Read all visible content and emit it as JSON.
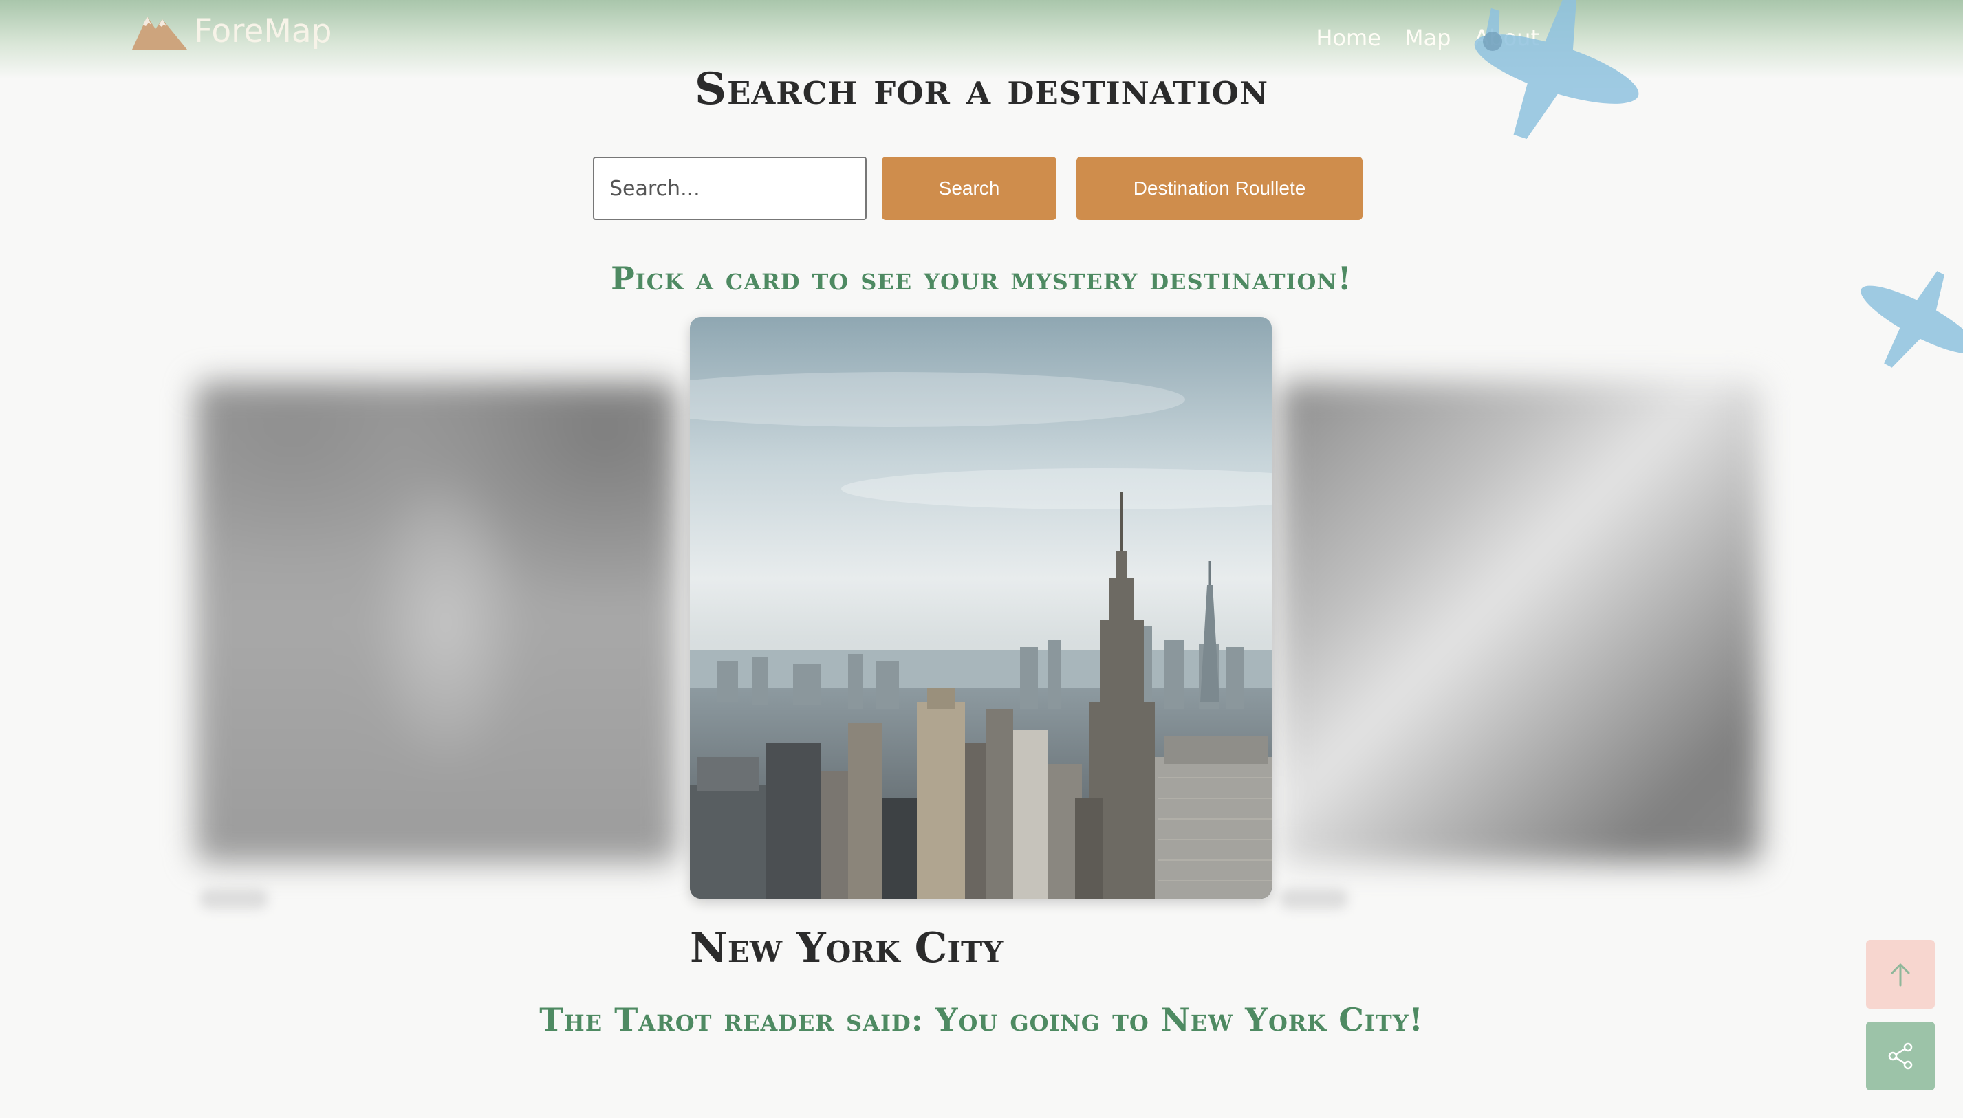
{
  "header": {
    "logo_text": "ForeMap",
    "nav": [
      {
        "label": "Home"
      },
      {
        "label": "Map"
      },
      {
        "label": "About"
      }
    ]
  },
  "page": {
    "title": "Search for a destination",
    "pick_prompt": "Pick a card to see your mystery destination!",
    "result_city": "New York City",
    "tarot_message": "The Tarot reader said: You going to New York City!"
  },
  "search": {
    "placeholder": "Search...",
    "value": "",
    "search_button": "Search",
    "roulette_button": "Destination Roullete"
  },
  "icons": {
    "logo": "mountain-icon",
    "scroll_top": "arrow-up-icon",
    "share": "share-icon",
    "decor": "airplane-icon"
  },
  "colors": {
    "accent_button": "#cf8d4c",
    "heading_green": "#4e8a62",
    "scroll_top_bg": "#f7d6cf",
    "share_bg": "#9cc3a8"
  }
}
